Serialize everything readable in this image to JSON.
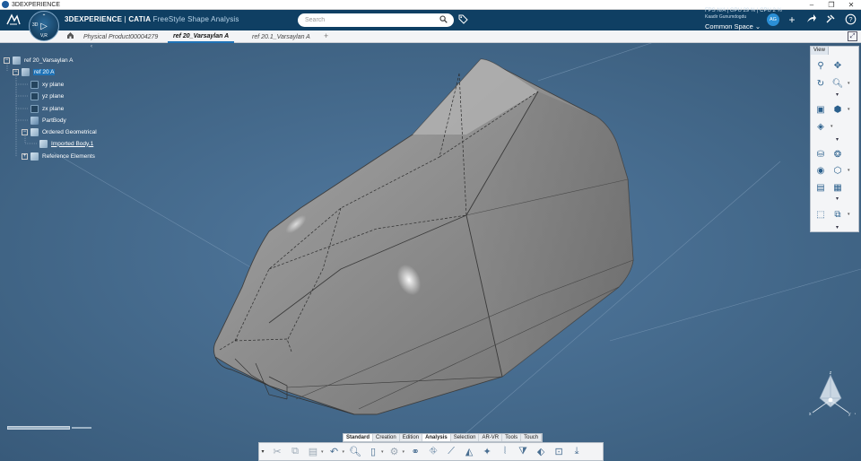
{
  "window": {
    "title": "3DEXPERIENCE",
    "controls": [
      "–",
      "❐",
      "✕"
    ]
  },
  "header": {
    "brand_bold": "3DEXPERIENCE",
    "brand_sep": " | ",
    "brand_product": "CATIA",
    "brand_app": " FreeStyle Shape Analysis",
    "compass_label": "V,R",
    "compass_3d": "3D",
    "search_placeholder": "Search",
    "user_name": "Kaadir Gunumdogdu",
    "space": "Common Space ⌄",
    "ghost_text": "FPS N/A | GPU 29 % | CPU 2 %",
    "avatar": "AG"
  },
  "tabs": [
    {
      "label": "Physical Product00004279",
      "active": false
    },
    {
      "label": "ref 20_Varsaylan A",
      "active": true
    },
    {
      "label": "ref 20.1_Varsaylan A",
      "active": false
    }
  ],
  "tree": {
    "root": "ref 20_Varsaylan A",
    "part": "ref 20 A",
    "children": [
      "xy plane",
      "yz plane",
      "zx plane",
      "PartBody",
      "Ordered Geometrical",
      "Imported Body.1",
      "Reference Elements"
    ]
  },
  "view_panel": {
    "title": "View"
  },
  "action_tabs": [
    {
      "label": "Standard",
      "active": true
    },
    {
      "label": "Creation",
      "active": false
    },
    {
      "label": "Edition",
      "active": false
    },
    {
      "label": "Analysis",
      "active": true
    },
    {
      "label": "Selection",
      "active": false
    },
    {
      "label": "AR-VR",
      "active": false
    },
    {
      "label": "Tools",
      "active": false
    },
    {
      "label": "Touch",
      "active": false
    }
  ],
  "icons": {
    "ds_logo": "3ds-logo-icon",
    "search": "search-icon",
    "tag": "tag-icon",
    "plus": "plus-icon",
    "share": "share-icon",
    "tools": "tools-icon",
    "help": "help-icon",
    "home": "home-icon"
  },
  "colors": {
    "header": "#0f3f63",
    "viewport": "#466a8c",
    "selection": "#1f73b7"
  }
}
